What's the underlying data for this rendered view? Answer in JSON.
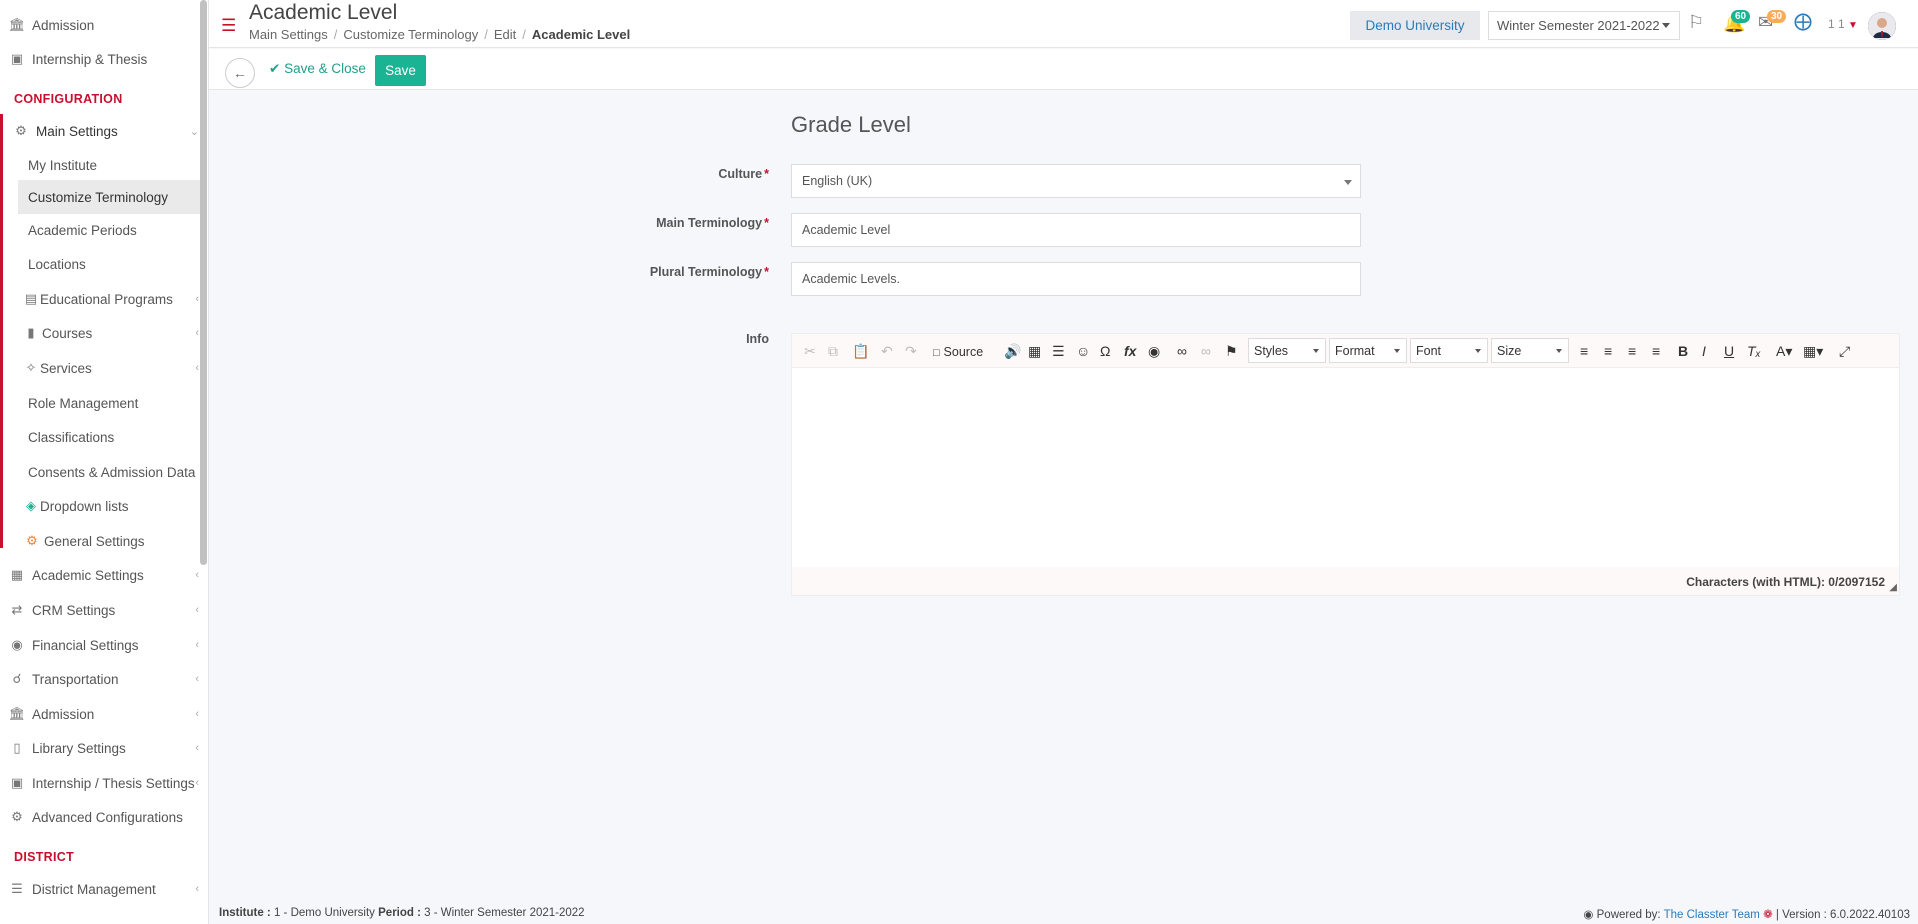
{
  "header": {
    "page_title": "Academic Level",
    "breadcrumb": [
      "Main Settings",
      "Customize Terminology",
      "Edit",
      "Academic Level"
    ],
    "university": "Demo University",
    "semester": "Winter Semester 2021-2022",
    "notifications_count": "60",
    "messages_count": "30",
    "user_count": "1 1"
  },
  "sidebar": {
    "top_items": [
      "Admission",
      "Internship & Thesis"
    ],
    "config_heading": "CONFIGURATION",
    "main_settings": "Main Settings",
    "sub_items": [
      "My Institute",
      "Customize Terminology",
      "Academic Periods",
      "Locations",
      "Educational Programs",
      "Courses",
      "Services",
      "Role Management",
      "Classifications",
      "Consents & Admission Data",
      "Dropdown lists",
      "General Settings"
    ],
    "settings_items": [
      "Academic Settings",
      "CRM Settings",
      "Financial Settings",
      "Transportation",
      "Admission",
      "Library Settings",
      "Internship / Thesis Settings",
      "Advanced Configurations"
    ],
    "district_heading": "DISTRICT",
    "district_item": "District Management"
  },
  "toolbar": {
    "save_close_label": "Save & Close",
    "save_label": "Save"
  },
  "form": {
    "title": "Grade Level",
    "culture_label": "Culture",
    "culture_value": "English (UK)",
    "main_term_label": "Main Terminology",
    "main_term_value": "Academic Level",
    "plural_term_label": "Plural Terminology",
    "plural_term_value": "Academic Levels.",
    "info_label": "Info",
    "editor": {
      "source_label": "Source",
      "styles_label": "Styles",
      "format_label": "Format",
      "font_label": "Font",
      "size_label": "Size",
      "char_count": "Characters (with HTML): 0/2097152"
    }
  },
  "footer": {
    "institute_label": "Institute :",
    "institute_value": "1 - Demo University",
    "period_label": "Period :",
    "period_value": "3 - Winter Semester 2021-2022",
    "powered_by": "Powered by:",
    "company": "The Classter Team",
    "version": "| Version : 6.0.2022.40103"
  },
  "colors": {
    "accent_red": "#c8102e",
    "save_green": "#1ab394",
    "link_blue": "#2b7bb9"
  }
}
